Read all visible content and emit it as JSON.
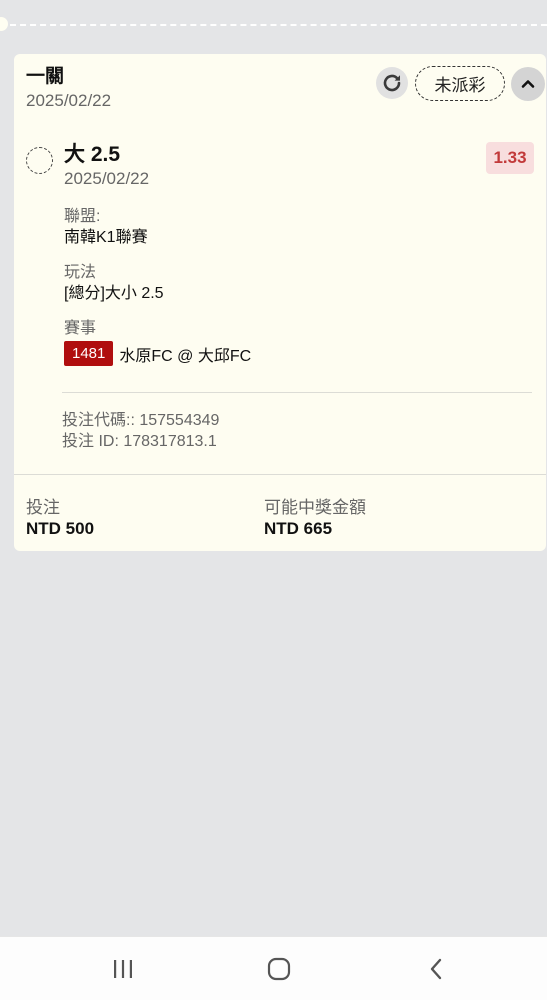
{
  "slip": {
    "type": "一關",
    "date": "2025/02/22",
    "status": "未派彩",
    "icons": {
      "refresh": "refresh-icon",
      "collapse": "chevron-up-icon"
    }
  },
  "selection": {
    "name": "大 2.5",
    "date": "2025/02/22",
    "odds": "1.33",
    "league_label": "聯盟:",
    "league": "南韓K1聯賽",
    "market_label": "玩法",
    "market": "[總分]大小 2.5",
    "event_label": "賽事",
    "event_id": "1481",
    "event_name": "水原FC @ 大邱FC"
  },
  "refs": {
    "bet_code": "投注代碼:: 157554349",
    "bet_id": "投注 ID: 178317813.1"
  },
  "footer": {
    "stake_label": "投注",
    "stake": "NTD 500",
    "payout_label": "可能中獎金額",
    "payout": "NTD 665"
  },
  "colors": {
    "odds_text": "#c23a3a",
    "odds_bg": "#f8dede",
    "event_badge": "#b00e0e",
    "card_bg": "#fefdf1"
  },
  "nav": {
    "icons": [
      "recent-apps-icon",
      "home-icon",
      "back-icon"
    ]
  }
}
